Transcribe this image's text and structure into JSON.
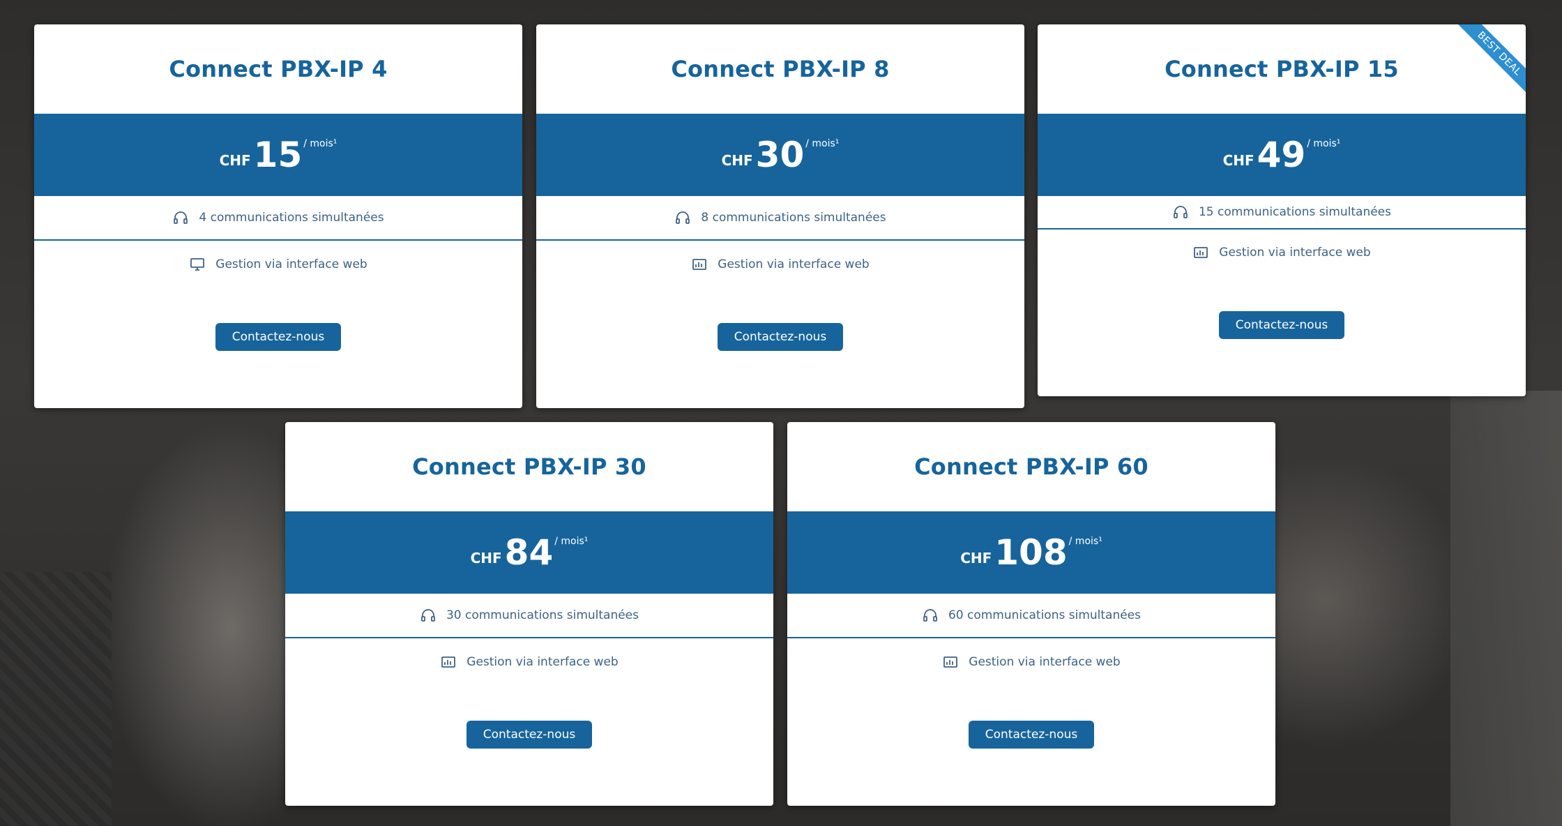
{
  "ribbon": "BEST DEAL",
  "plans": [
    {
      "title": "Connect PBX-IP 4",
      "currency": "CHF",
      "amount": "15",
      "period": "/ mois¹",
      "feature1": "4 communications simultanées",
      "feature2": "Gestion via interface web",
      "feature2_icon": "monitor-icon",
      "button": "Contactez-nous"
    },
    {
      "title": "Connect PBX-IP 8",
      "currency": "CHF",
      "amount": "30",
      "period": "/ mois¹",
      "feature1": "8 communications simultanées",
      "feature2": "Gestion via interface web",
      "feature2_icon": "dashboard-icon",
      "button": "Contactez-nous"
    },
    {
      "title": "Connect PBX-IP 15",
      "currency": "CHF",
      "amount": "49",
      "period": "/ mois¹",
      "feature1": "15 communications simultanées",
      "feature2": "Gestion via interface web",
      "feature2_icon": "dashboard-icon",
      "button": "Contactez-nous"
    },
    {
      "title": "Connect PBX-IP 30",
      "currency": "CHF",
      "amount": "84",
      "period": "/ mois¹",
      "feature1": "30 communications simultanées",
      "feature2": "Gestion via interface web",
      "feature2_icon": "dashboard-icon",
      "button": "Contactez-nous"
    },
    {
      "title": "Connect PBX-IP 60",
      "currency": "CHF",
      "amount": "108",
      "period": "/ mois¹",
      "feature1": "60 communications simultanées",
      "feature2": "Gestion via interface web",
      "feature2_icon": "dashboard-icon",
      "button": "Contactez-nous"
    }
  ],
  "colors": {
    "brand": "#17649c",
    "ribbon": "#2d8fd0",
    "text": "#3e6284"
  }
}
